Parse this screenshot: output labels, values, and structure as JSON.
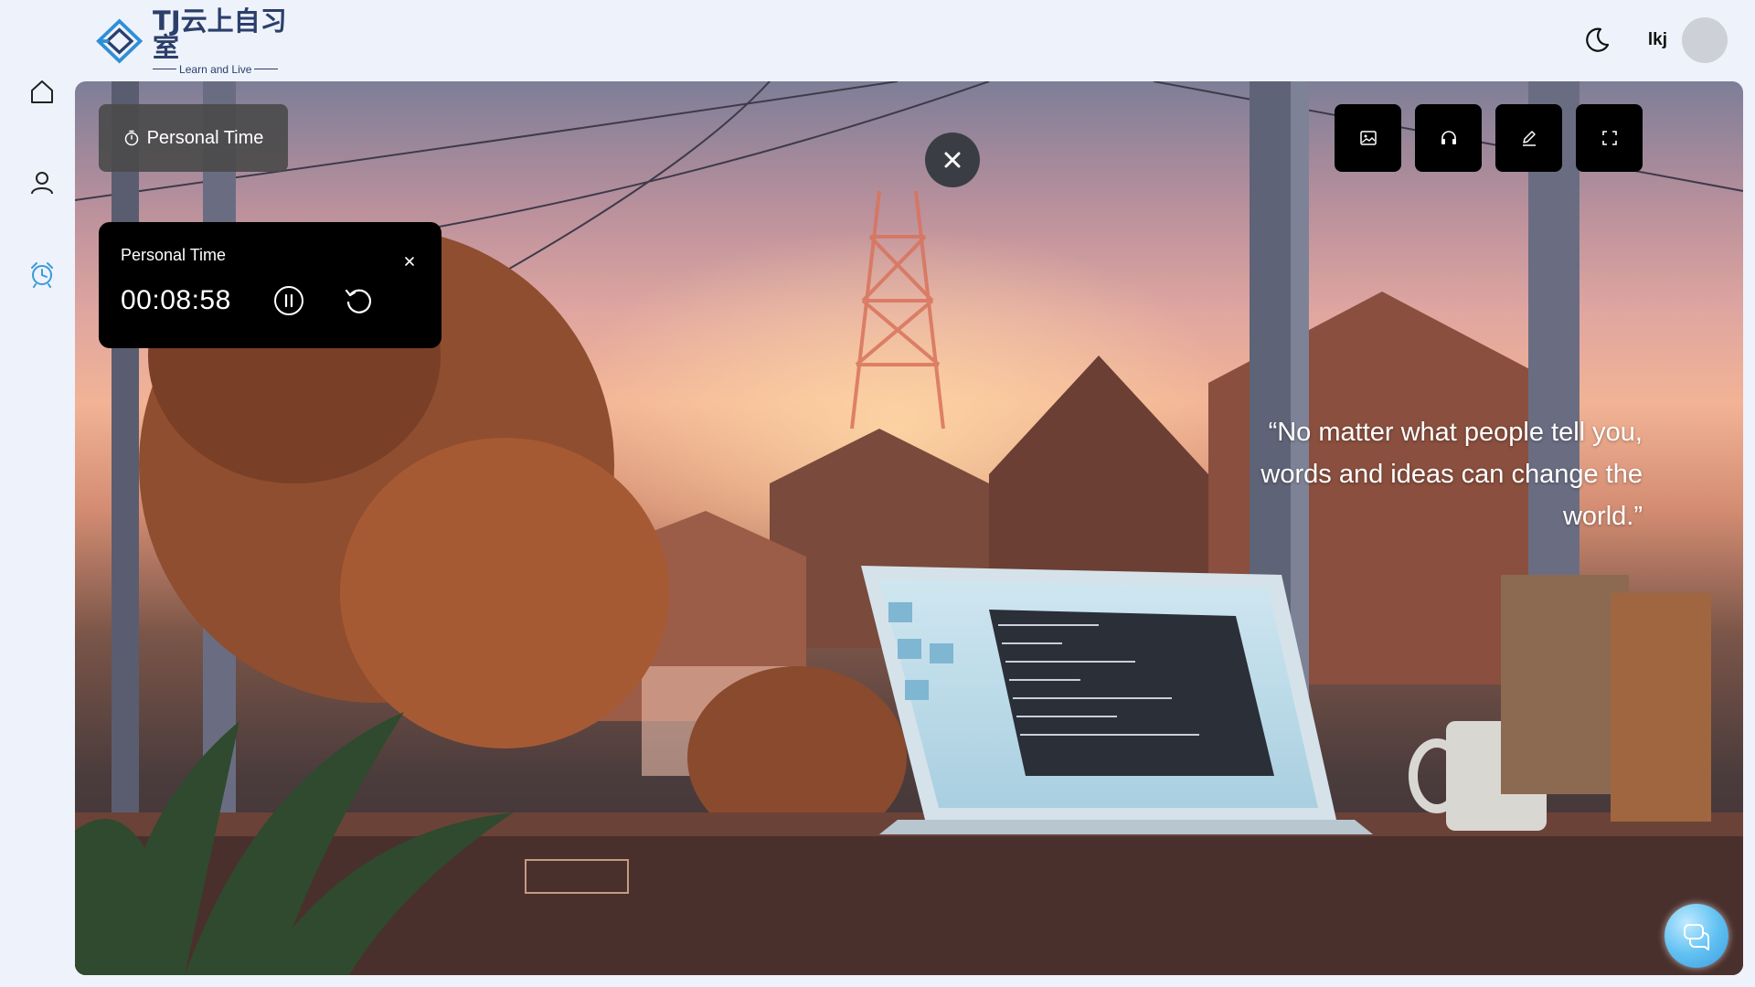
{
  "header": {
    "logo_title": "TJ云上自习室",
    "logo_subtitle": "Learn and Live",
    "theme_icon": "moon-icon",
    "username": "lkj"
  },
  "sidebar": {
    "items": [
      {
        "icon": "home-icon",
        "active": false
      },
      {
        "icon": "user-icon",
        "active": false
      },
      {
        "icon": "alarm-clock-icon",
        "active": true
      }
    ],
    "active_color": "#3a9ad9"
  },
  "stage": {
    "close_icon": "close-icon",
    "pill_label": "Personal Time",
    "timer": {
      "title": "Personal Time",
      "value": "00:08:58"
    },
    "toolbar": [
      "image-icon",
      "headphones-icon",
      "pen-icon",
      "fullscreen-icon"
    ],
    "quote": "“No matter what people tell you, words and ideas can change the world.”",
    "chat_icon": "chat-icon"
  }
}
